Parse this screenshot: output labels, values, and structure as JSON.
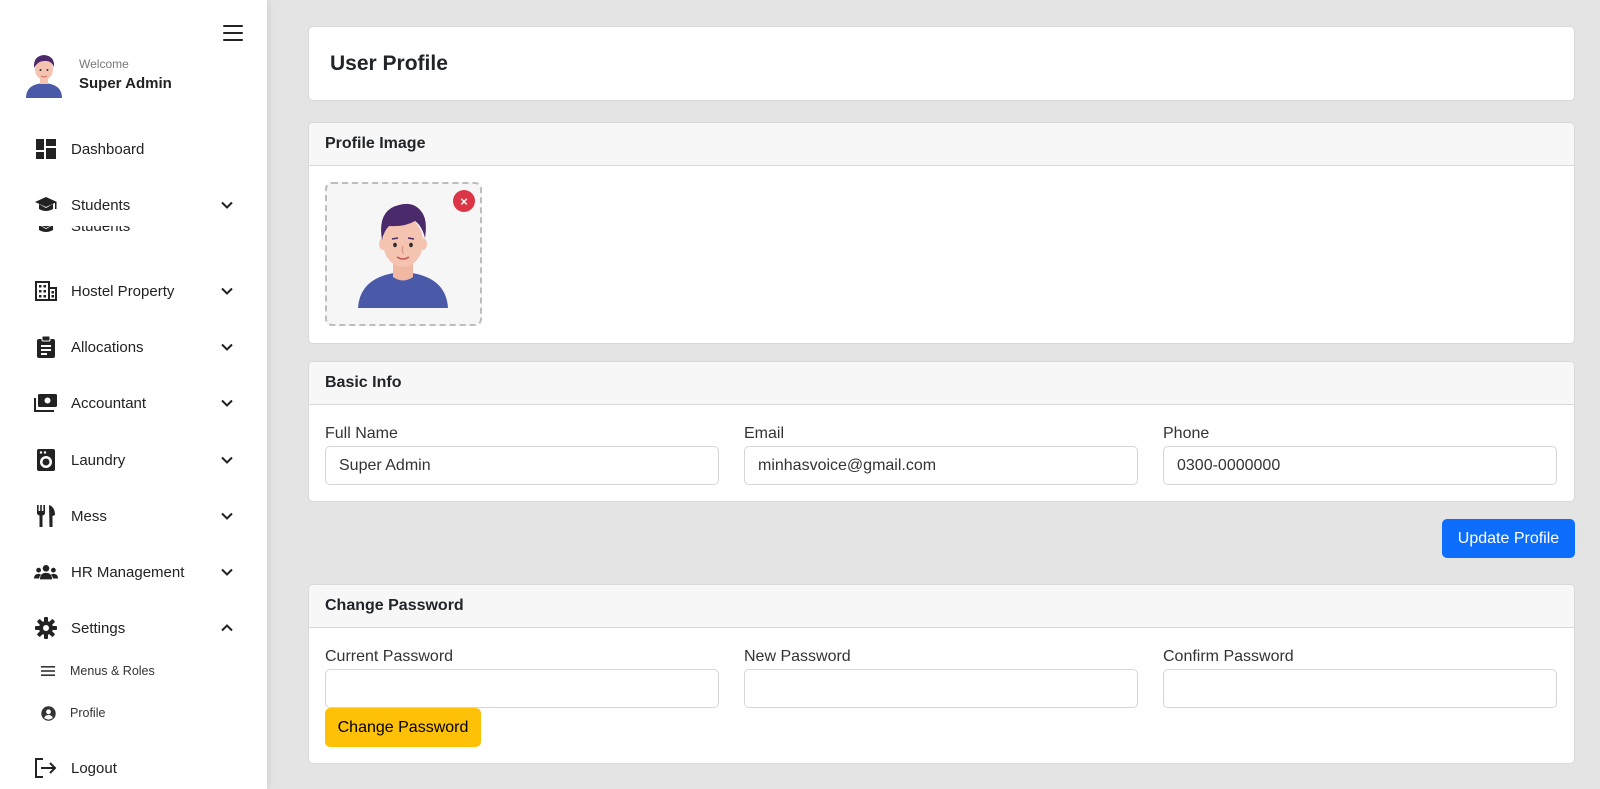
{
  "sidebar": {
    "welcome": "Welcome",
    "user_name": "Super Admin",
    "items": [
      {
        "label": "Dashboard",
        "icon": "dashboard-icon"
      },
      {
        "label": "Students",
        "icon": "graduation-cap-icon"
      },
      {
        "label": "Hostel Property",
        "icon": "building-icon"
      },
      {
        "label": "Allocations",
        "icon": "clipboard-icon"
      },
      {
        "label": "Accountant",
        "icon": "money-icon"
      },
      {
        "label": "Laundry",
        "icon": "washing-machine-icon"
      },
      {
        "label": "Mess",
        "icon": "utensils-icon"
      },
      {
        "label": "HR Management",
        "icon": "users-icon"
      },
      {
        "label": "Settings",
        "icon": "gear-icon"
      },
      {
        "label": "Logout",
        "icon": "logout-icon"
      }
    ],
    "ghost_label": "Students",
    "sub_items": [
      {
        "label": "Menus & Roles",
        "icon": "list-icon"
      },
      {
        "label": "Profile",
        "icon": "user-circle-icon"
      }
    ]
  },
  "page": {
    "title": "User Profile"
  },
  "profile_image": {
    "header": "Profile Image",
    "remove_symbol": "×"
  },
  "basic_info": {
    "header": "Basic Info",
    "full_name_label": "Full Name",
    "full_name_value": "Super Admin",
    "email_label": "Email",
    "email_value": "minhasvoice@gmail.com",
    "phone_label": "Phone",
    "phone_value": "0300-0000000",
    "update_button": "Update Profile"
  },
  "change_password": {
    "header": "Change Password",
    "current_label": "Current Password",
    "new_label": "New Password",
    "confirm_label": "Confirm Password",
    "button": "Change Password"
  },
  "colors": {
    "primary": "#0d6efd",
    "warning": "#ffc107",
    "danger": "#dc3545",
    "avatar_hair": "#4a2a6b",
    "avatar_shirt": "#4b5aa8",
    "avatar_skin": "#f5c4b0"
  }
}
